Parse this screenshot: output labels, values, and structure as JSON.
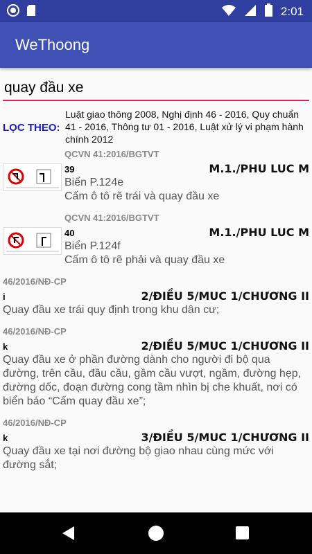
{
  "status": {
    "time": "2:01",
    "icons": [
      "radio-circle-icon",
      "sd-card-icon",
      "wifi-icon",
      "signal-icon",
      "battery-icon"
    ]
  },
  "app": {
    "title": "WeThoong"
  },
  "search": {
    "value": "quay đầu xe"
  },
  "filter": {
    "label": "LỌC THEO:",
    "value": "Luật giao thông 2008, Nghị định 46 - 2016, Quy chuẩn 41 - 2016, Thông tư 01 - 2016, Luật xử lý vi phạm hành chính 2012"
  },
  "results": [
    {
      "source": "QCVN 41:2016/BGTVT",
      "number": "39",
      "location": "M.1./PHU LUC M",
      "subtitle": "Biển P.124e",
      "description": "Cấm ô tô rẽ trái và quay đầu xe",
      "thumb_icon": "no-left-turn-sign-icon"
    },
    {
      "source": "QCVN 41:2016/BGTVT",
      "number": "40",
      "location": "M.1./PHU LUC M",
      "subtitle": "Biển P.124f",
      "description": "Cấm ô tô rẽ phải và quay đầu xe",
      "thumb_icon": "no-right-turn-sign-icon"
    },
    {
      "source": "46/2016/NĐ-CP",
      "number": "i",
      "location": "2/ĐIỀU 5/MUC 1/CHƯƠNG II",
      "description": "Quay đầu xe trái quy định trong khu dân cư;"
    },
    {
      "source": "46/2016/NĐ-CP",
      "number": "k",
      "location": "2/ĐIỀU 5/MUC 1/CHƯƠNG II",
      "description": "Quay đầu xe ở phần đường dành cho người đi bộ qua đường, trên cầu, đầu cầu, gầm cầu vượt, ngầm, đường hẹp, đường dốc, đoạn đường cong tầm nhìn bị che khuất, nơi có biển báo “Cấm quay đầu xe”;"
    },
    {
      "source": "46/2016/NĐ-CP",
      "number": "k",
      "location": "3/ĐIỀU 5/MUC 1/CHƯƠNG II",
      "description": "Quay đầu xe tại nơi đường bộ giao nhau cùng mức với đường sắt;"
    }
  ]
}
